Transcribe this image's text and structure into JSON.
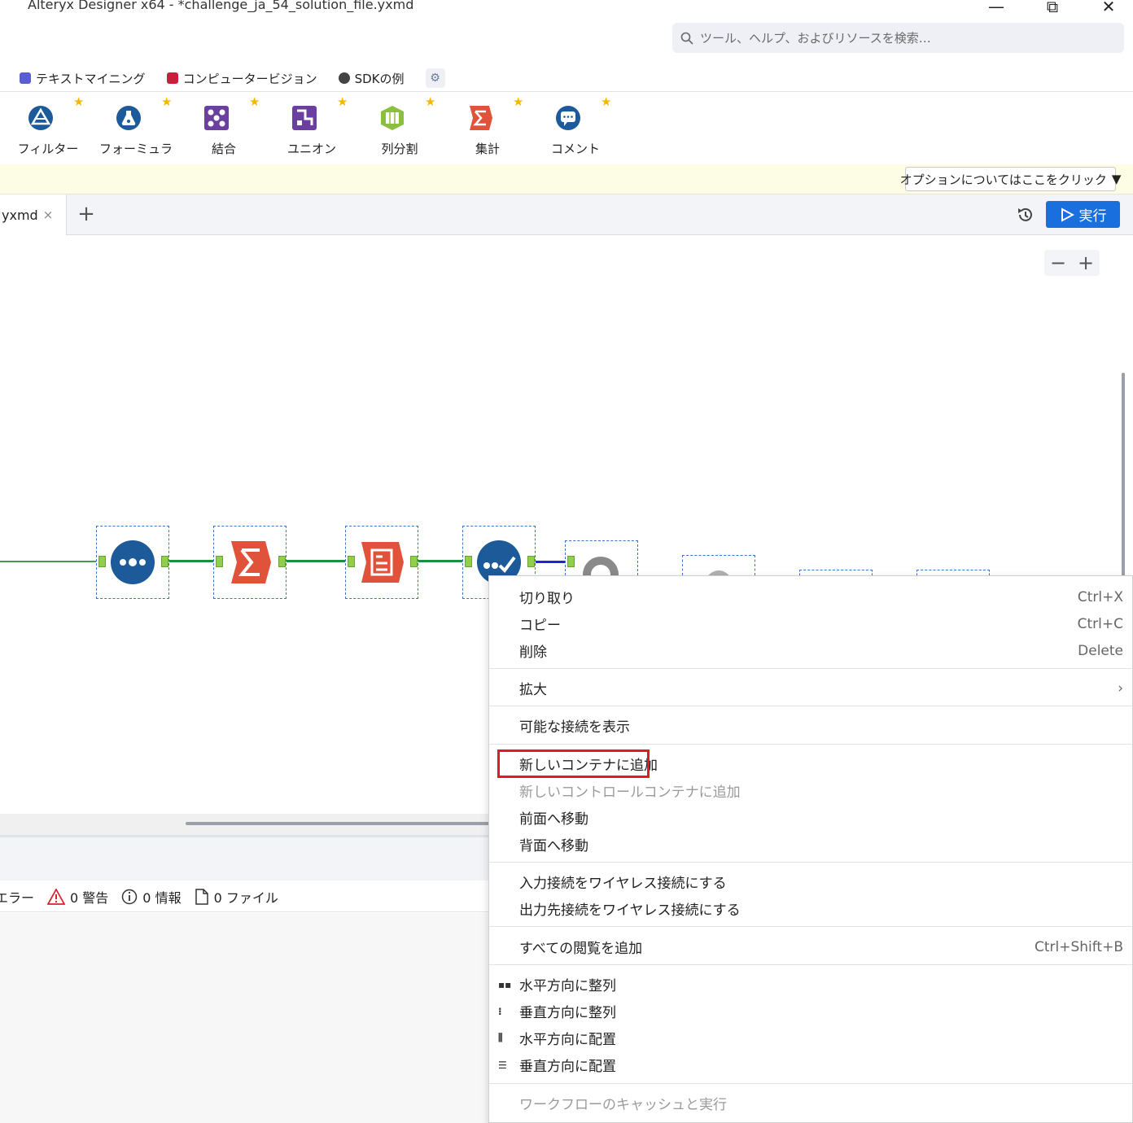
{
  "window": {
    "title": "Alteryx Designer x64 - *challenge_ja_54_solution_file.yxmd",
    "minimize": "—",
    "restore": "⧉",
    "close": "✕"
  },
  "search": {
    "placeholder": "ツール、ヘルプ、およびリソースを検索…"
  },
  "categories": [
    {
      "label": "テキストマイニング",
      "color": "#5a5fd0"
    },
    {
      "label": "コンピュータービジョン",
      "color": "#c8203a"
    },
    {
      "label": "SDKの例",
      "color": "#444444"
    }
  ],
  "palette": [
    {
      "label": "フィルター",
      "icon": "filter-icon",
      "color": "#1c5a99"
    },
    {
      "label": "フォーミュラ",
      "icon": "formula-icon",
      "color": "#1c5a99"
    },
    {
      "label": "結合",
      "icon": "join-icon",
      "color": "#6b3fa0"
    },
    {
      "label": "ユニオン",
      "icon": "union-icon",
      "color": "#6b3fa0"
    },
    {
      "label": "列分割",
      "icon": "text-to-columns-icon",
      "color": "#8cbf3f"
    },
    {
      "label": "集計",
      "icon": "summarize-icon",
      "color": "#e0533a"
    },
    {
      "label": "コメント",
      "icon": "comment-icon",
      "color": "#1c5a99"
    }
  ],
  "options_button": {
    "label": "オプションについてはここをクリック",
    "arrow": "▼"
  },
  "doc_tab": {
    "label": "yxmd",
    "close": "×",
    "add": "+"
  },
  "run_button": {
    "label": "実行"
  },
  "zoom": {
    "minus": "−",
    "plus": "+"
  },
  "results": {
    "errors": "エラー",
    "warnings": "0 警告",
    "info": "0 情報",
    "files": "0 ファイル"
  },
  "context_menu": {
    "cut": {
      "label": "切り取り",
      "shortcut": "Ctrl+X"
    },
    "copy": {
      "label": "コピー",
      "shortcut": "Ctrl+C"
    },
    "delete": {
      "label": "削除",
      "shortcut": "Delete"
    },
    "zoom": {
      "label": "拡大",
      "arrow": "›"
    },
    "show_connections": {
      "label": "可能な接続を表示"
    },
    "add_container": {
      "label": "新しいコンテナに追加"
    },
    "add_control_container": {
      "label": "新しいコントロールコンテナに追加"
    },
    "bring_front": {
      "label": "前面へ移動"
    },
    "send_back": {
      "label": "背面へ移動"
    },
    "wireless_input": {
      "label": "入力接続をワイヤレス接続にする"
    },
    "wireless_output": {
      "label": "出力先接続をワイヤレス接続にする"
    },
    "add_all_browse": {
      "label": "すべての閲覧を追加",
      "shortcut": "Ctrl+Shift+B"
    },
    "align_horizontal": {
      "label": "水平方向に整列"
    },
    "align_vertical": {
      "label": "垂直方向に整列"
    },
    "distribute_horizontal": {
      "label": "水平方向に配置"
    },
    "distribute_vertical": {
      "label": "垂直方向に配置"
    },
    "cache_run": {
      "label": "ワークフローのキャッシュと実行"
    }
  }
}
